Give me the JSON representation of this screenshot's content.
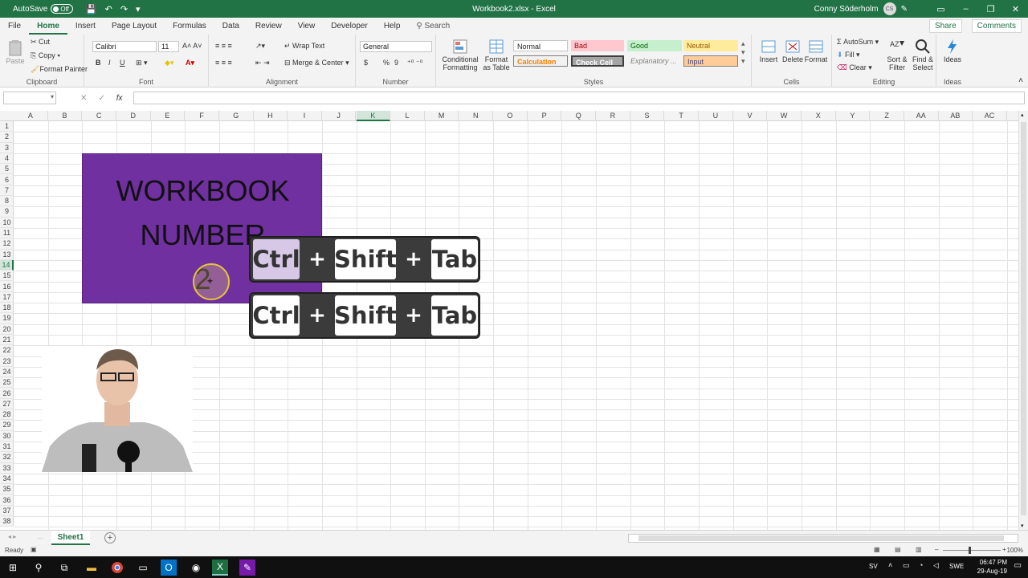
{
  "titlebar": {
    "autosave_label": "AutoSave",
    "autosave_state": "Off",
    "window_title": "Workbook2.xlsx  -  Excel",
    "user_name": "Conny Söderholm",
    "user_initials": "CS"
  },
  "tabs": [
    "File",
    "Home",
    "Insert",
    "Page Layout",
    "Formulas",
    "Data",
    "Review",
    "View",
    "Developer",
    "Help"
  ],
  "active_tab": "Home",
  "search_label": "Search",
  "share_label": "Share",
  "comments_label": "Comments",
  "ribbon": {
    "clipboard": {
      "paste": "Paste",
      "cut": "Cut",
      "copy": "Copy",
      "format_painter": "Format Painter",
      "label": "Clipboard"
    },
    "font": {
      "name": "Calibri",
      "size": "11",
      "label": "Font",
      "bold": "B",
      "italic": "I",
      "underline": "U"
    },
    "alignment": {
      "wrap": "Wrap Text",
      "merge": "Merge & Center",
      "label": "Alignment"
    },
    "number": {
      "format": "General",
      "label": "Number",
      "currency": "$",
      "percent": "%",
      "comma": "9"
    },
    "styles": {
      "conditional": "Conditional Formatting",
      "format_table": "Format as Table",
      "normal": "Normal",
      "bad": "Bad",
      "good": "Good",
      "neutral": "Neutral",
      "calculation": "Calculation",
      "check_cell": "Check Cell",
      "explanatory": "Explanatory ...",
      "input": "Input",
      "label": "Styles"
    },
    "cells": {
      "insert": "Insert",
      "delete": "Delete",
      "format": "Format",
      "label": "Cells"
    },
    "editing": {
      "autosum": "AutoSum",
      "fill": "Fill",
      "clear": "Clear",
      "sort": "Sort & Filter",
      "find": "Find & Select",
      "label": "Editing"
    },
    "ideas": {
      "button": "Ideas",
      "label": "Ideas"
    }
  },
  "formula_bar": {
    "fx": "fx"
  },
  "columns": [
    "A",
    "B",
    "C",
    "D",
    "E",
    "F",
    "G",
    "H",
    "I",
    "J",
    "K",
    "L",
    "M",
    "N",
    "O",
    "P",
    "Q",
    "R",
    "S",
    "T",
    "U",
    "V",
    "W",
    "X",
    "Y",
    "Z",
    "AA",
    "AB",
    "AC"
  ],
  "active_column": "K",
  "active_row": 14,
  "rows": [
    1,
    2,
    3,
    4,
    5,
    6,
    7,
    8,
    9,
    10,
    11,
    12,
    13,
    14,
    15,
    16,
    17,
    18,
    19,
    20,
    21,
    22,
    23,
    24,
    25,
    26,
    27,
    28,
    29,
    30,
    31,
    32,
    33,
    34,
    35,
    36,
    37,
    38
  ],
  "shape": {
    "line1": "WORKBOOK",
    "line2": "NUMBER",
    "line3": "2"
  },
  "shortcut": {
    "key1": "Ctrl",
    "plus": "+",
    "key2": "Shift",
    "key3": "Tab"
  },
  "sheet_tab": "Sheet1",
  "status": {
    "ready": "Ready",
    "zoom": "100%"
  },
  "taskbar": {
    "lang_short": "SV",
    "lang": "SWE",
    "time": "06:47 PM",
    "date": "29-Aug-19"
  }
}
